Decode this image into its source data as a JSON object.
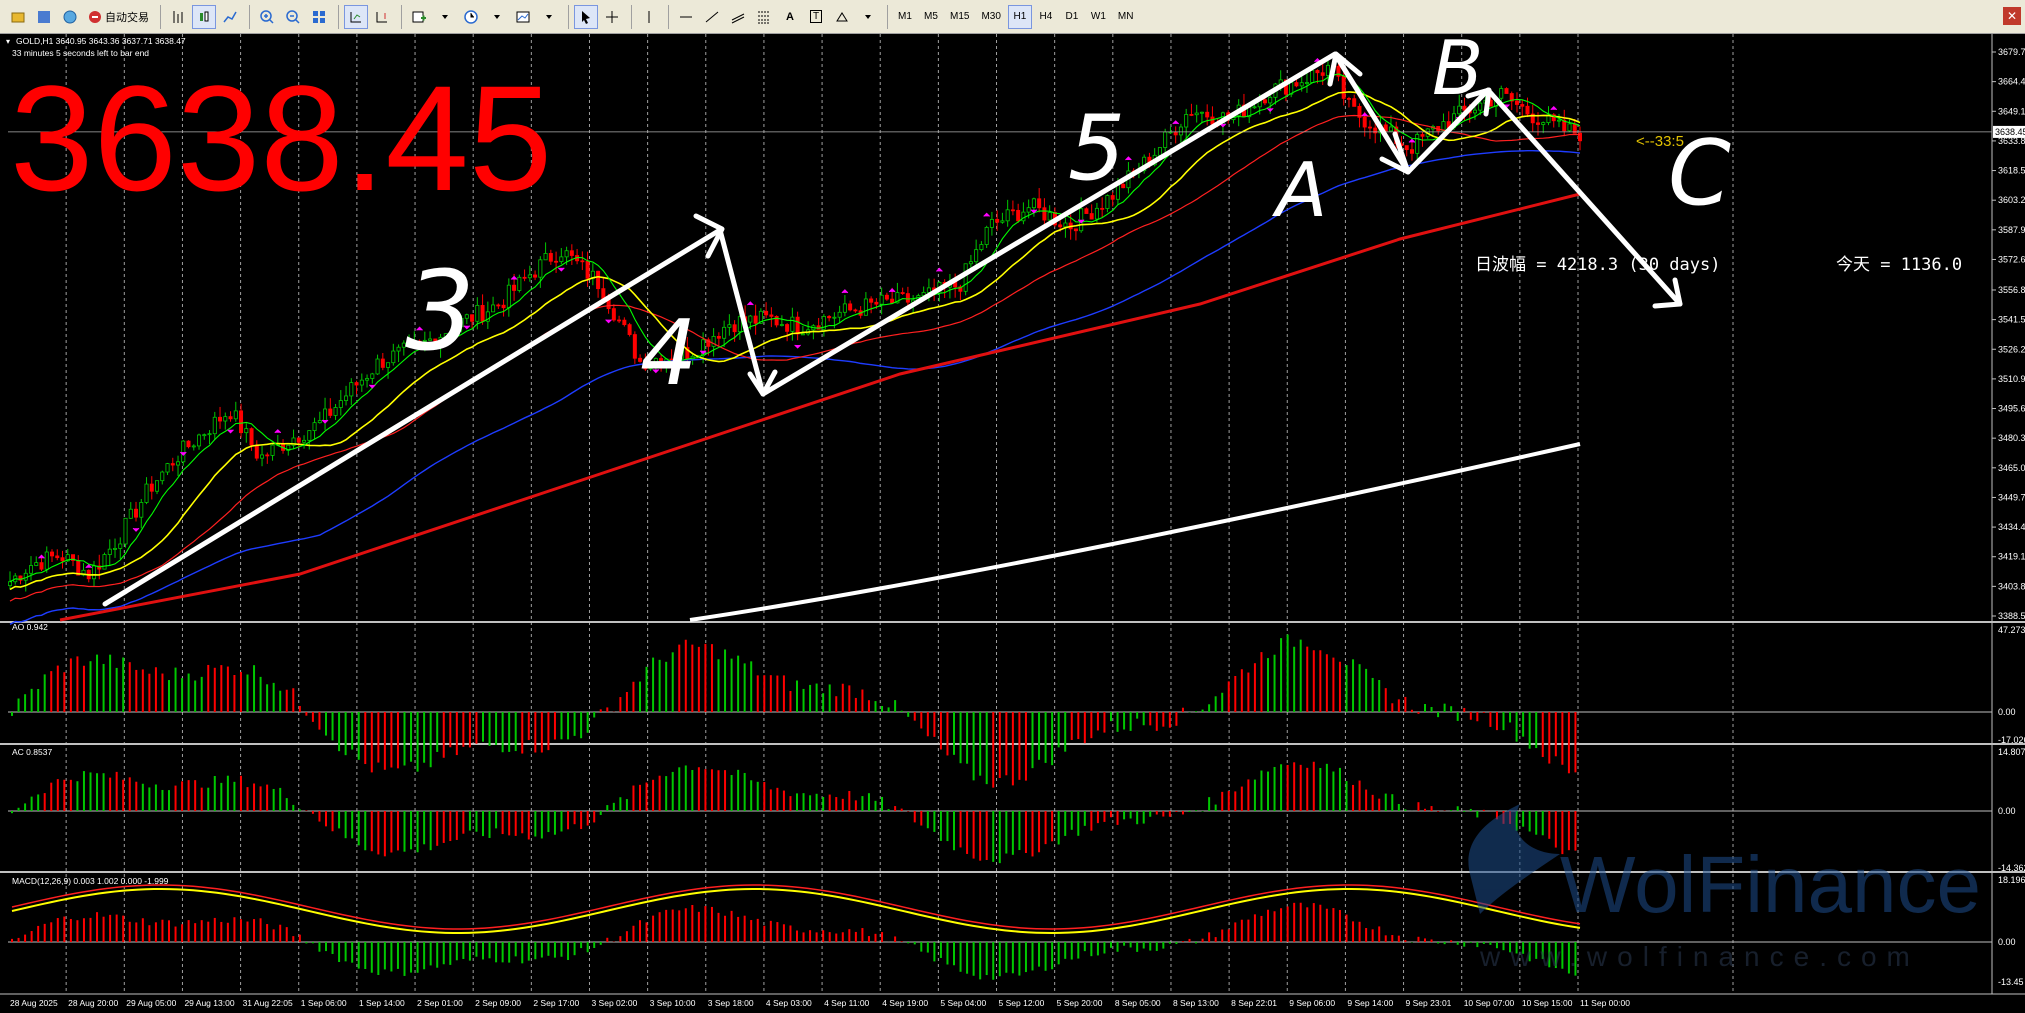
{
  "toolbar": {
    "auto_trade_label": "自动交易",
    "timeframes": [
      "M1",
      "M5",
      "M15",
      "M30",
      "H1",
      "H4",
      "D1",
      "W1",
      "MN"
    ],
    "active_timeframe": "H1",
    "text_tool": "A",
    "text_label_tool": "T"
  },
  "chart": {
    "symbol_info": "GOLD,H1  3640.95 3643.36 3637.71 3638.47",
    "bar_timer": "33 minutes 5 seconds left to bar end",
    "big_price": "3638.45",
    "big_price_color": "#ff0000",
    "range_label": "日波幅 = 4218.3   (30 days)",
    "today_label": "今天 = 1136.0",
    "countdown_marker": "<--33:5",
    "current_price_tag": "3638.45",
    "price_scale": [
      "3679.70",
      "3664.40",
      "3649.10",
      "3633.80",
      "3618.50",
      "3603.20",
      "3587.90",
      "3572.60",
      "3556.85",
      "3541.55",
      "3526.25",
      "3510.95",
      "3495.65",
      "3480.35",
      "3465.05",
      "3449.75",
      "3434.45",
      "3419.15",
      "3403.85",
      "3388.55"
    ],
    "time_labels": [
      "28 Aug 2025",
      "28 Aug 20:00",
      "29 Aug 05:00",
      "29 Aug 13:00",
      "31 Aug 22:05",
      "1 Sep 06:00",
      "1 Sep 14:00",
      "2 Sep 01:00",
      "2 Sep 09:00",
      "2 Sep 17:00",
      "3 Sep 02:00",
      "3 Sep 10:00",
      "3 Sep 18:00",
      "4 Sep 03:00",
      "4 Sep 11:00",
      "4 Sep 19:00",
      "5 Sep 04:00",
      "5 Sep 12:00",
      "5 Sep 20:00",
      "8 Sep 05:00",
      "8 Sep 13:00",
      "8 Sep 22:01",
      "9 Sep 06:00",
      "9 Sep 14:00",
      "9 Sep 23:01",
      "10 Sep 07:00",
      "10 Sep 15:00",
      "11 Sep 00:00"
    ],
    "wave_labels": [
      "3",
      "4",
      "5",
      "A",
      "B",
      "C"
    ],
    "watermark": "WolFinance",
    "watermark_url": "www.wolfinance.com"
  },
  "indicators": {
    "ao": {
      "label": "AO 0.942",
      "scale": [
        "47.273",
        "0.00",
        "-17.026"
      ]
    },
    "ac": {
      "label": "AC 0.8537",
      "scale": [
        "14.8072",
        "0.00",
        "-14.3626"
      ]
    },
    "macd": {
      "label": "MACD(12,26,9) 0.003 1.002 0.000 -1.999",
      "scale": [
        "18.196",
        "0.00",
        "-13.45"
      ]
    }
  },
  "colors": {
    "bull": "#00c800",
    "bear": "#ff0000",
    "ma_fast": "#00ff00",
    "ma_yellow": "#ffff00",
    "ma_red": "#ff2020",
    "ma_blue": "#1e3cff",
    "ma_slow": "#e01010",
    "fractal": "#ff00ff",
    "annotation": "#ffffff",
    "macd_signal": "#ffff00",
    "macd_line": "#ff2020"
  }
}
